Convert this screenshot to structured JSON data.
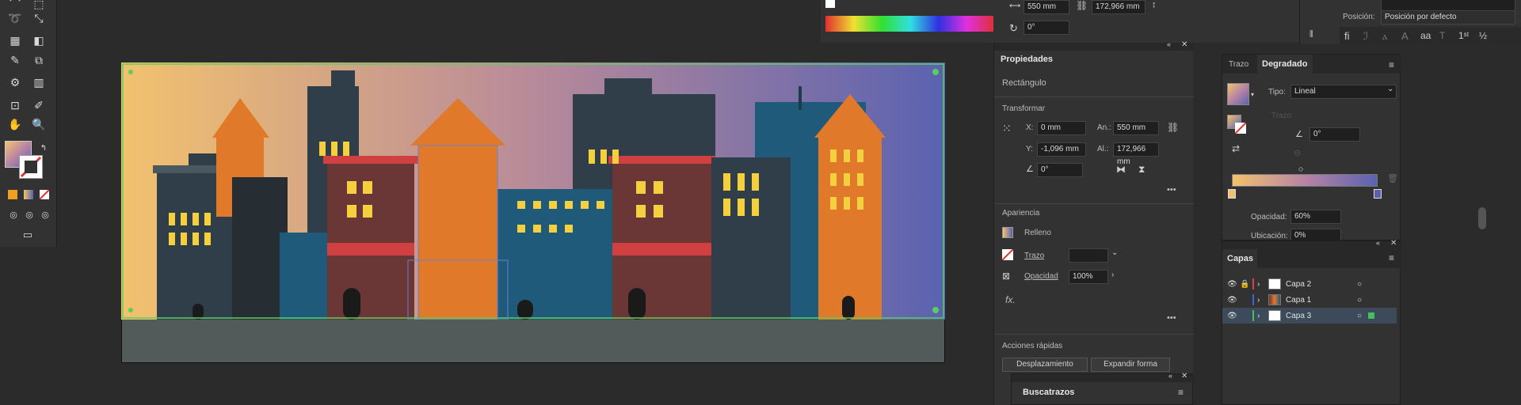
{
  "top_fields": {
    "width_value": "550 mm",
    "height_value": "172,966 mm",
    "rotate_value": "0°"
  },
  "properties": {
    "title": "Propiedades",
    "object_type": "Rectángulo",
    "transform_title": "Transformar",
    "x_label": "X:",
    "x_value": "0 mm",
    "y_label": "Y:",
    "y_value": "-1,096 mm",
    "w_label": "An.:",
    "w_value": "550 mm",
    "h_label": "Al.:",
    "h_value": "172,966 mm",
    "angle_value": "0°",
    "appearance_title": "Apariencia",
    "fill_label": "Relleno",
    "stroke_label": "Trazo",
    "opacity_label": "Opacidad",
    "opacity_value": "100%",
    "fx_label": "fx.",
    "quick_actions_title": "Acciones rápidas",
    "quick_btn_1": "Desplazamiento",
    "quick_btn_2": "Expandir forma",
    "more": "•••"
  },
  "gradient": {
    "tab_stroke": "Trazo",
    "tab_gradient": "Degradado",
    "type_label": "Tipo:",
    "type_value": "Lineal",
    "stroke_label": "Trazo",
    "angle_value": "0°",
    "opacity_label": "Opacidad:",
    "opacity_value": "60%",
    "location_label": "Ubicación:",
    "location_value": "0%",
    "colors": {
      "start": "#f2c26e",
      "end": "#5a62b0"
    }
  },
  "layers": {
    "title": "Capas",
    "items": [
      {
        "name": "Capa 2",
        "color": "#e04040",
        "locked": true
      },
      {
        "name": "Capa 1",
        "color": "#4060e0",
        "locked": false
      },
      {
        "name": "Capa 3",
        "color": "#40c060",
        "locked": false,
        "selected": true
      }
    ]
  },
  "character": {
    "position_label": "Posición:",
    "position_value": "Posición por defecto"
  },
  "pathfinder": {
    "title": "Buscatrazos"
  }
}
